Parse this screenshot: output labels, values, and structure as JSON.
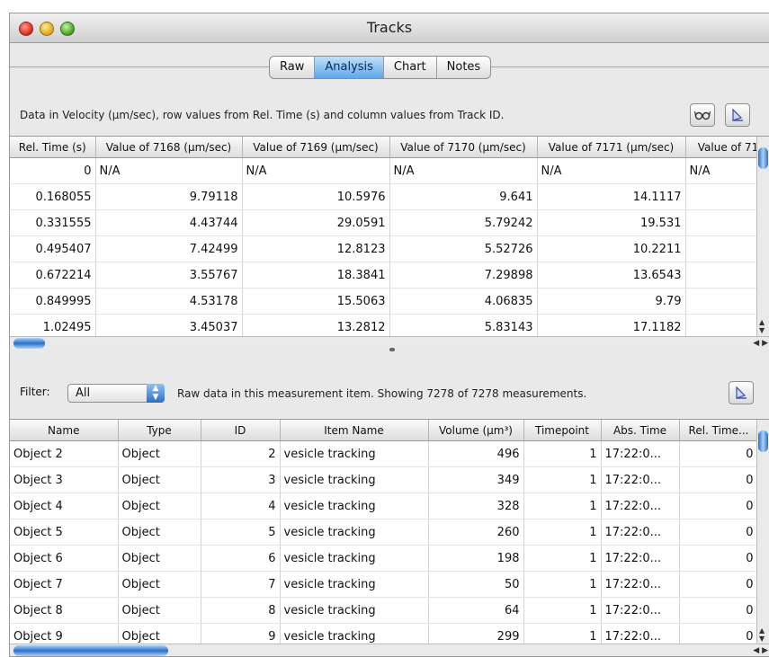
{
  "window": {
    "title": "Tracks"
  },
  "tabs": [
    "Raw",
    "Analysis",
    "Chart",
    "Notes"
  ],
  "active_tab": "Analysis",
  "analysis": {
    "info": "Data in Velocity (µm/sec), row values from Rel. Time (s) and column values from Track ID.",
    "glasses_icon": "glasses-icon",
    "export_icon": "export-icon",
    "columns": [
      "Rel. Time (s)",
      "Value of 7168 (µm/sec)",
      "Value of 7169 (µm/sec)",
      "Value of 7170 (µm/sec)",
      "Value of 7171 (µm/sec)",
      "Value of 71"
    ],
    "rows": [
      [
        "0",
        "N/A",
        "N/A",
        "N/A",
        "N/A",
        "N/A"
      ],
      [
        "0.168055",
        "9.79118",
        "10.5976",
        "9.641",
        "14.1117",
        ""
      ],
      [
        "0.331555",
        "4.43744",
        "29.0591",
        "5.79242",
        "19.531",
        ""
      ],
      [
        "0.495407",
        "7.42499",
        "12.8123",
        "5.52726",
        "10.2211",
        ""
      ],
      [
        "0.672214",
        "3.55767",
        "18.3841",
        "7.29898",
        "13.6543",
        ""
      ],
      [
        "0.849995",
        "4.53178",
        "15.5063",
        "4.06835",
        "9.79",
        ""
      ],
      [
        "1.02495",
        "3.45037",
        "13.2812",
        "5.83143",
        "17.1182",
        ""
      ]
    ]
  },
  "raw": {
    "filter_label": "Filter:",
    "filter_value": "All",
    "info": "Raw data in this measurement item.  Showing 7278 of 7278 measurements.",
    "columns": [
      "Name",
      "Type",
      "ID",
      "Item Name",
      "Volume (µm³)",
      "Timepoint",
      "Abs. Time",
      "Rel. Time..."
    ],
    "rows": [
      [
        "Object 2",
        "Object",
        "2",
        "vesicle tracking",
        "496",
        "1",
        "17:22:0...",
        "0"
      ],
      [
        "Object 3",
        "Object",
        "3",
        "vesicle tracking",
        "349",
        "1",
        "17:22:0...",
        "0"
      ],
      [
        "Object 4",
        "Object",
        "4",
        "vesicle tracking",
        "328",
        "1",
        "17:22:0...",
        "0"
      ],
      [
        "Object 5",
        "Object",
        "5",
        "vesicle tracking",
        "260",
        "1",
        "17:22:0...",
        "0"
      ],
      [
        "Object 6",
        "Object",
        "6",
        "vesicle tracking",
        "198",
        "1",
        "17:22:0...",
        "0"
      ],
      [
        "Object 7",
        "Object",
        "7",
        "vesicle tracking",
        "50",
        "1",
        "17:22:0...",
        "0"
      ],
      [
        "Object 8",
        "Object",
        "8",
        "vesicle tracking",
        "64",
        "1",
        "17:22:0...",
        "0"
      ],
      [
        "Object 9",
        "Object",
        "9",
        "vesicle tracking",
        "299",
        "1",
        "17:22:0...",
        "0"
      ]
    ],
    "row_marker_colors": [
      "#7ed957",
      "#e85a5a",
      "#d98be8",
      "#e8e85a",
      "#d5e87a",
      "#3a4ee8",
      "#7ed957",
      "#e85a5a"
    ]
  }
}
